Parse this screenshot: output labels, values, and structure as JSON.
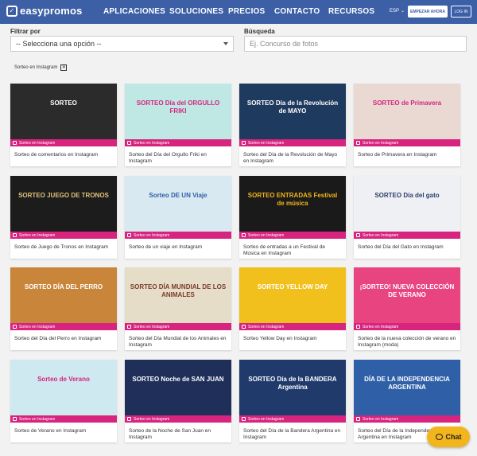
{
  "header": {
    "logo": "easypromos",
    "nav": [
      "APLICACIONES",
      "SOLUCIONES",
      "PRECIOS",
      "CONTACTO",
      "RECURSOS"
    ],
    "lang": "ESP",
    "start_button": "EMPEZAR AHORA",
    "login_button": "LOG IN"
  },
  "filters": {
    "filter_label": "Filtrar por",
    "select_value": "-- Selecciona una opción --",
    "search_label": "Búsqueda",
    "search_placeholder": "Ej. Concurso de fotos",
    "active_tag": "Sorteo en Instagram"
  },
  "cards": [
    {
      "title": "Sorteo de comentarios en Instagram",
      "badge": "Sorteo en Instagram",
      "thumb_text": "SORTEO",
      "bg": "#2b2b2b",
      "fg": "#ffffff"
    },
    {
      "title": "Sorteo del Día del Orgullo Friki en Instagram",
      "badge": "Sorteo en Instagram",
      "thumb_text": "SORTEO Día del ORGULLO FRIKI",
      "bg": "#bfe8e4",
      "fg": "#d6247f"
    },
    {
      "title": "Sorteo del Día de la Revolución de Mayo en Instagram",
      "badge": "Sorteo en Instagram",
      "thumb_text": "SORTEO Día de la Revolución de MAYO",
      "bg": "#1f3a5f",
      "fg": "#ffffff"
    },
    {
      "title": "Sorteo de Primavera en Instagram",
      "badge": "Sorteo en Instagram",
      "thumb_text": "SORTEO de Primavera",
      "bg": "#e9d9d2",
      "fg": "#d6247f"
    },
    {
      "title": "Sorteo de Juego de Tronos en Instagram",
      "badge": "Sorteo en Instagram",
      "thumb_text": "SORTEO JUEGO DE TRONOS",
      "bg": "#1c1c1c",
      "fg": "#e0c27a"
    },
    {
      "title": "Sorteo de un viaje en Instagram",
      "badge": "Sorteo en Instagram",
      "thumb_text": "Sorteo DE UN Viaje",
      "bg": "#d8e9f2",
      "fg": "#2f5fa6"
    },
    {
      "title": "Sorteo de entradas a un Festival de Música en Instagram",
      "badge": "Sorteo en Instagram",
      "thumb_text": "SORTEO ENTRADAS Festival de música",
      "bg": "#1a1a1a",
      "fg": "#f2b51c"
    },
    {
      "title": "Sorteo del Día del Gato en Instagram",
      "badge": "Sorteo en Instagram",
      "thumb_text": "SORTEO Día del gato",
      "bg": "#eef0f4",
      "fg": "#2f3f6b"
    },
    {
      "title": "Sorteo del Día del Perro en Instagram",
      "badge": "Sorteo en Instagram",
      "thumb_text": "SORTEO DÍA DEL PERRO",
      "bg": "#c9853a",
      "fg": "#ffffff"
    },
    {
      "title": "Sorteo del Día Mundial de los Animales en Instagram",
      "badge": "Sorteo en Instagram",
      "thumb_text": "SORTEO DÍA MUNDIAL DE LOS ANIMALES",
      "bg": "#e6ddc9",
      "fg": "#7a3d2a"
    },
    {
      "title": "Sorteo Yellow Day en Instagram",
      "badge": "Sorteo en Instagram",
      "thumb_text": "SORTEO YELLOW DAY",
      "bg": "#f2c01c",
      "fg": "#ffffff"
    },
    {
      "title": "Sorteo de la nueva colección de verano en Instagram (moda)",
      "badge": "Sorteo en Instagram",
      "thumb_text": "¡SORTEO! NUEVA COLECCIÓN DE VERANO",
      "bg": "#e8447f",
      "fg": "#ffffff"
    },
    {
      "title": "Sorteo de Verano en Instagram",
      "badge": "Sorteo en Instagram",
      "thumb_text": "Sorteo de Verano",
      "bg": "#cfe9f0",
      "fg": "#d6247f"
    },
    {
      "title": "Sorteo de la Noche de San Juan en Instagram",
      "badge": "Sorteo en Instagram",
      "thumb_text": "SORTEO Noche de SAN JUAN",
      "bg": "#1f2f5a",
      "fg": "#ffffff"
    },
    {
      "title": "Sorteo del Día de la Bandera Argentina en Instagram",
      "badge": "Sorteo en Instagram",
      "thumb_text": "SORTEO Día de la BANDERA Argentina",
      "bg": "#1f3a6b",
      "fg": "#ffffff"
    },
    {
      "title": "Sorteo del Día de la Independencia Argentina en Instagram",
      "badge": "Sorteo en Instagram",
      "thumb_text": "DÍA DE LA INDEPENDENCIA ARGENTINA",
      "bg": "#2f5fa6",
      "fg": "#ffffff"
    }
  ],
  "chat": {
    "label": "Chat"
  }
}
